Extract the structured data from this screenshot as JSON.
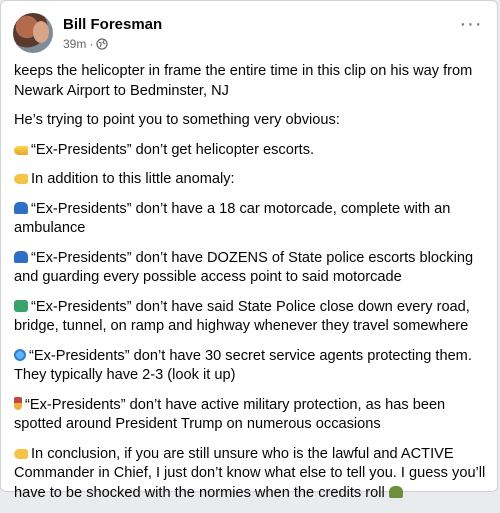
{
  "post": {
    "author": "Bill Foresman",
    "timestamp": "39m",
    "separator": "·",
    "audience_icon": "globe-icon",
    "more_label": "···",
    "paragraphs": [
      {
        "emoji": "",
        "text": "keeps the helicopter in frame the entire time in this clip on his way from Newark Airport to Bedminster, NJ"
      },
      {
        "emoji": "",
        "text": "He’s trying to point you to something very obvious:"
      },
      {
        "emoji": "helicopter-emoji",
        "text": "“Ex-Presidents” don’t get helicopter escorts."
      },
      {
        "emoji": "point-right-emoji",
        "text": "In addition to this little anomaly:"
      },
      {
        "emoji": "car-emoji",
        "text": "“Ex-Presidents” don’t have a 18 car motorcade, complete with an ambulance"
      },
      {
        "emoji": "police-car-emoji",
        "text": "“Ex-Presidents” don’t have DOZENS of State police escorts blocking and guarding every possible access point to said motorcade"
      },
      {
        "emoji": "road-emoji",
        "text": "“Ex-Presidents” don’t have said State Police close down every road, bridge, tunnel, on ramp and highway whenever they travel somewhere"
      },
      {
        "emoji": "globe-emoji",
        "text": "“Ex-Presidents” don’t have 30 secret service agents protecting them. They typically have 2-3 (look it up)"
      },
      {
        "emoji": "medal-emoji",
        "text": "“Ex-Presidents” don’t have active military protection, as has been spotted around President Trump on numerous occasions"
      },
      {
        "emoji": "point-right-emoji",
        "text": "In conclusion, if you are still unsure who is the lawful and ACTIVE Commander in Chief, I just don’t know what else to tell you. I guess you’ll have to be shocked with the normies when the credits roll",
        "trailing_emoji": "guard-emoji"
      }
    ]
  }
}
